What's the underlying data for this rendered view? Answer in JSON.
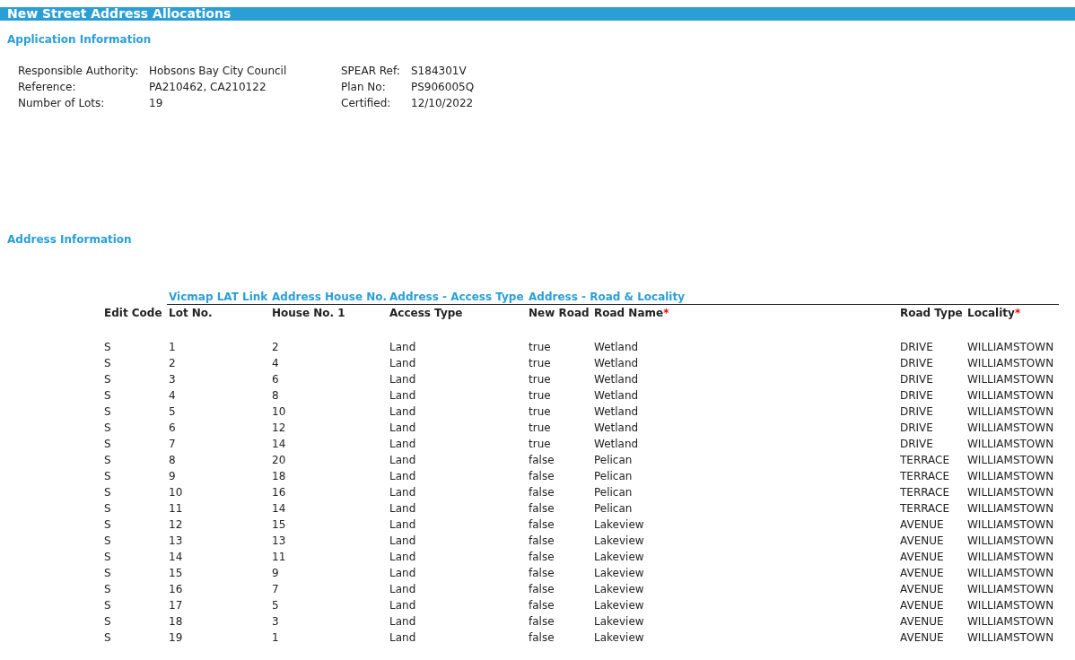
{
  "title": "New Street Address Allocations",
  "application_section": {
    "heading": "Application Information",
    "left_fields": [
      {
        "label": "Responsible Authority:",
        "value": "Hobsons Bay City Council"
      },
      {
        "label": "Reference:",
        "value": "PA210462, CA210122"
      },
      {
        "label": "Number of Lots:",
        "value": "19"
      }
    ],
    "right_fields": [
      {
        "label": "SPEAR Ref:",
        "value": "S184301V"
      },
      {
        "label": "Plan No:",
        "value": "PS906005Q"
      },
      {
        "label": "Certified:",
        "value": "12/10/2022"
      }
    ]
  },
  "address_section": {
    "heading": "Address Information",
    "table": {
      "column_groups": [
        {
          "columns": [
            {
              "label": "Edit Code"
            }
          ]
        },
        {
          "label": "Vicmap LAT Link",
          "columns": [
            {
              "label": "Lot No."
            }
          ]
        },
        {
          "label": "Address House No.",
          "columns": [
            {
              "label": "House No. 1"
            }
          ]
        },
        {
          "label": "Address - Access Type",
          "columns": [
            {
              "label": "Access Type"
            }
          ]
        },
        {
          "label": "Address - Road & Locality",
          "columns": [
            {
              "label": "New Road"
            },
            {
              "label": "Road Name",
              "required_mark": "*"
            },
            {
              "label": "Road Type"
            },
            {
              "label": "Locality",
              "required_mark": "*"
            }
          ]
        }
      ],
      "rows": [
        [
          "S",
          "1",
          "2",
          "Land",
          "true",
          "Wetland",
          "DRIVE",
          "WILLIAMSTOWN"
        ],
        [
          "S",
          "2",
          "4",
          "Land",
          "true",
          "Wetland",
          "DRIVE",
          "WILLIAMSTOWN"
        ],
        [
          "S",
          "3",
          "6",
          "Land",
          "true",
          "Wetland",
          "DRIVE",
          "WILLIAMSTOWN"
        ],
        [
          "S",
          "4",
          "8",
          "Land",
          "true",
          "Wetland",
          "DRIVE",
          "WILLIAMSTOWN"
        ],
        [
          "S",
          "5",
          "10",
          "Land",
          "true",
          "Wetland",
          "DRIVE",
          "WILLIAMSTOWN"
        ],
        [
          "S",
          "6",
          "12",
          "Land",
          "true",
          "Wetland",
          "DRIVE",
          "WILLIAMSTOWN"
        ],
        [
          "S",
          "7",
          "14",
          "Land",
          "true",
          "Wetland",
          "DRIVE",
          "WILLIAMSTOWN"
        ],
        [
          "S",
          "8",
          "20",
          "Land",
          "false",
          "Pelican",
          "TERRACE",
          "WILLIAMSTOWN"
        ],
        [
          "S",
          "9",
          "18",
          "Land",
          "false",
          "Pelican",
          "TERRACE",
          "WILLIAMSTOWN"
        ],
        [
          "S",
          "10",
          "16",
          "Land",
          "false",
          "Pelican",
          "TERRACE",
          "WILLIAMSTOWN"
        ],
        [
          "S",
          "11",
          "14",
          "Land",
          "false",
          "Pelican",
          "TERRACE",
          "WILLIAMSTOWN"
        ],
        [
          "S",
          "12",
          "15",
          "Land",
          "false",
          "Lakeview",
          "AVENUE",
          "WILLIAMSTOWN"
        ],
        [
          "S",
          "13",
          "13",
          "Land",
          "false",
          "Lakeview",
          "AVENUE",
          "WILLIAMSTOWN"
        ],
        [
          "S",
          "14",
          "11",
          "Land",
          "false",
          "Lakeview",
          "AVENUE",
          "WILLIAMSTOWN"
        ],
        [
          "S",
          "15",
          "9",
          "Land",
          "false",
          "Lakeview",
          "AVENUE",
          "WILLIAMSTOWN"
        ],
        [
          "S",
          "16",
          "7",
          "Land",
          "false",
          "Lakeview",
          "AVENUE",
          "WILLIAMSTOWN"
        ],
        [
          "S",
          "17",
          "5",
          "Land",
          "false",
          "Lakeview",
          "AVENUE",
          "WILLIAMSTOWN"
        ],
        [
          "S",
          "18",
          "3",
          "Land",
          "false",
          "Lakeview",
          "AVENUE",
          "WILLIAMSTOWN"
        ],
        [
          "S",
          "19",
          "1",
          "Land",
          "false",
          "Lakeview",
          "AVENUE",
          "WILLIAMSTOWN"
        ]
      ]
    }
  }
}
